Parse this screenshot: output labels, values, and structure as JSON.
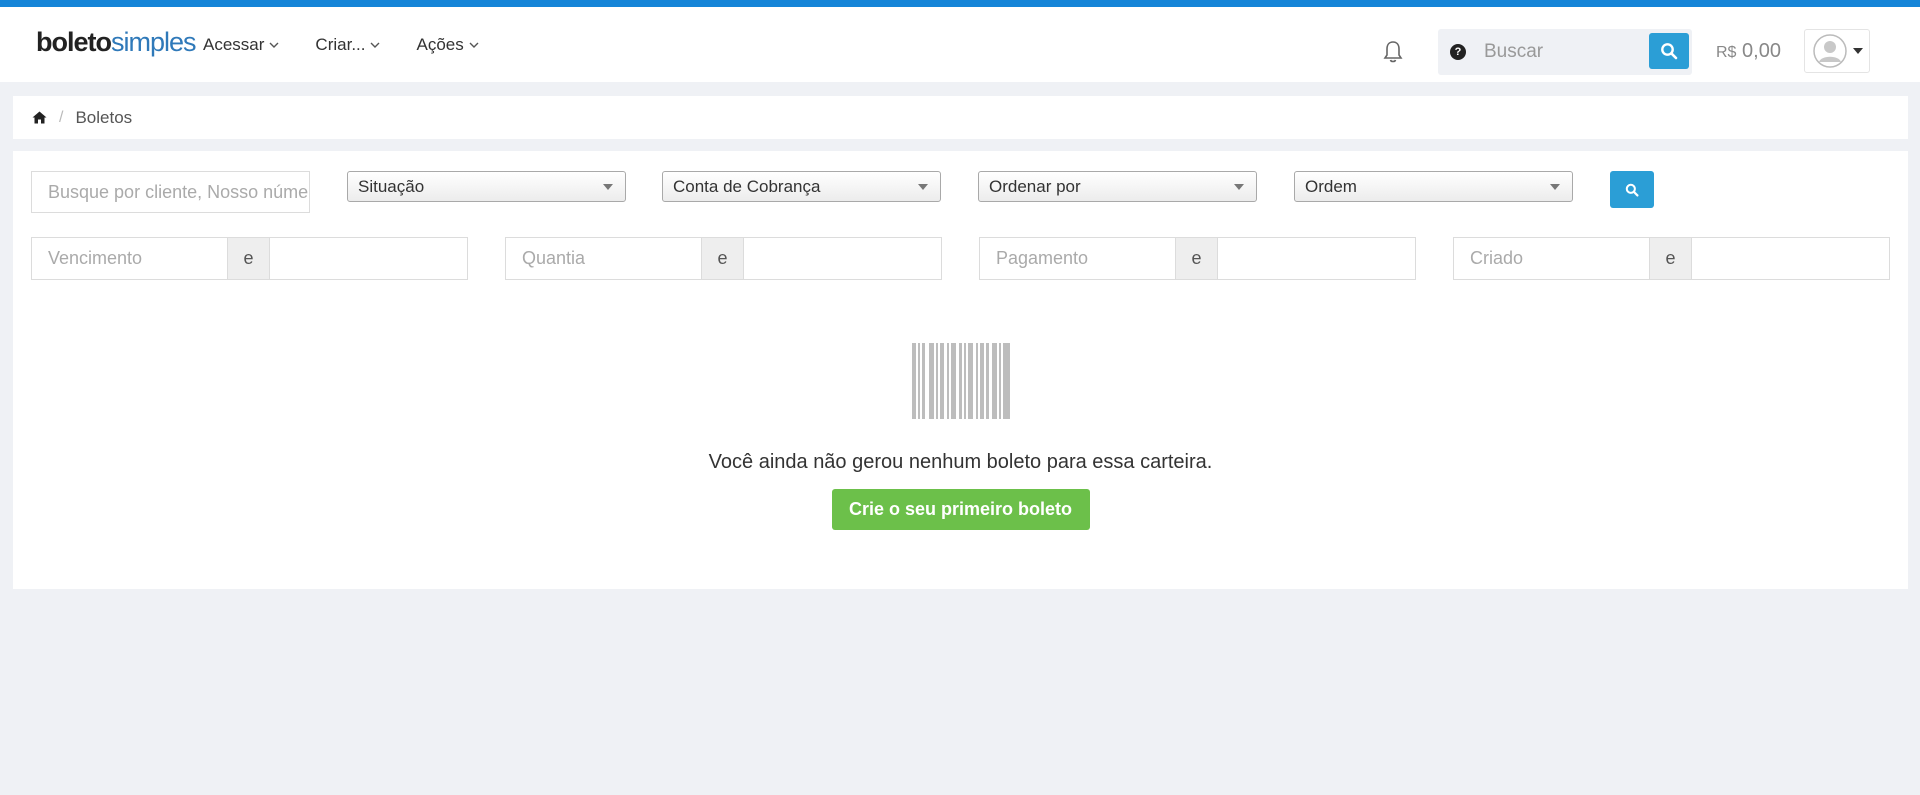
{
  "brand": {
    "logo_part1": "boleto",
    "logo_part2": "simples"
  },
  "nav": {
    "items": [
      {
        "label": "Acessar"
      },
      {
        "label": "Criar..."
      },
      {
        "label": "Ações"
      }
    ]
  },
  "header": {
    "search_placeholder": "Buscar",
    "help_glyph": "?",
    "balance_currency": "R$",
    "balance_value": "0,00"
  },
  "breadcrumb": {
    "current": "Boletos"
  },
  "filters": {
    "search_placeholder": "Busque por cliente, Nosso número",
    "selects": [
      {
        "label": "Situação"
      },
      {
        "label": "Conta de Cobrança"
      },
      {
        "label": "Ordenar por"
      },
      {
        "label": "Ordem"
      }
    ],
    "ranges": [
      {
        "from_placeholder": "Vencimento",
        "separator": "e"
      },
      {
        "from_placeholder": "Quantia",
        "separator": "e"
      },
      {
        "from_placeholder": "Pagamento",
        "separator": "e"
      },
      {
        "from_placeholder": "Criado",
        "separator": "e"
      }
    ]
  },
  "empty_state": {
    "icon": "barcode-icon",
    "message": "Você ainda não gerou nenhum boleto para essa carteira.",
    "cta_label": "Crie o seu primeiro boleto"
  },
  "colors": {
    "accent": "#1585d8",
    "primary_button": "#2b9ed6",
    "success_button": "#6cc04a",
    "page_background": "#eff1f5"
  }
}
